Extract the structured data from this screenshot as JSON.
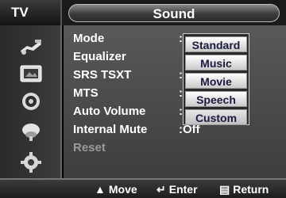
{
  "header": {
    "tv_label": "TV",
    "title": "Sound"
  },
  "sidebar": {
    "icons": [
      "input-icon",
      "picture-icon",
      "sound-icon",
      "channel-icon",
      "setup-icon"
    ]
  },
  "menu": {
    "items": [
      {
        "label": "Mode"
      },
      {
        "label": "Equalizer"
      },
      {
        "label": "SRS TSXT"
      },
      {
        "label": "MTS"
      },
      {
        "label": "Auto Volume"
      },
      {
        "label": "Internal Mute",
        "value": "Off"
      },
      {
        "label": "Reset"
      }
    ],
    "colon": ":"
  },
  "dropdown": {
    "options": [
      "Standard",
      "Music",
      "Movie",
      "Speech",
      "Custom"
    ],
    "selected": "Custom"
  },
  "footer": {
    "move_label": "Move",
    "enter_label": "Enter",
    "return_label": "Return"
  },
  "colors": {
    "panel": "#4a4a4a",
    "header": "#1a1a1a",
    "highlight": "#ffffff"
  }
}
